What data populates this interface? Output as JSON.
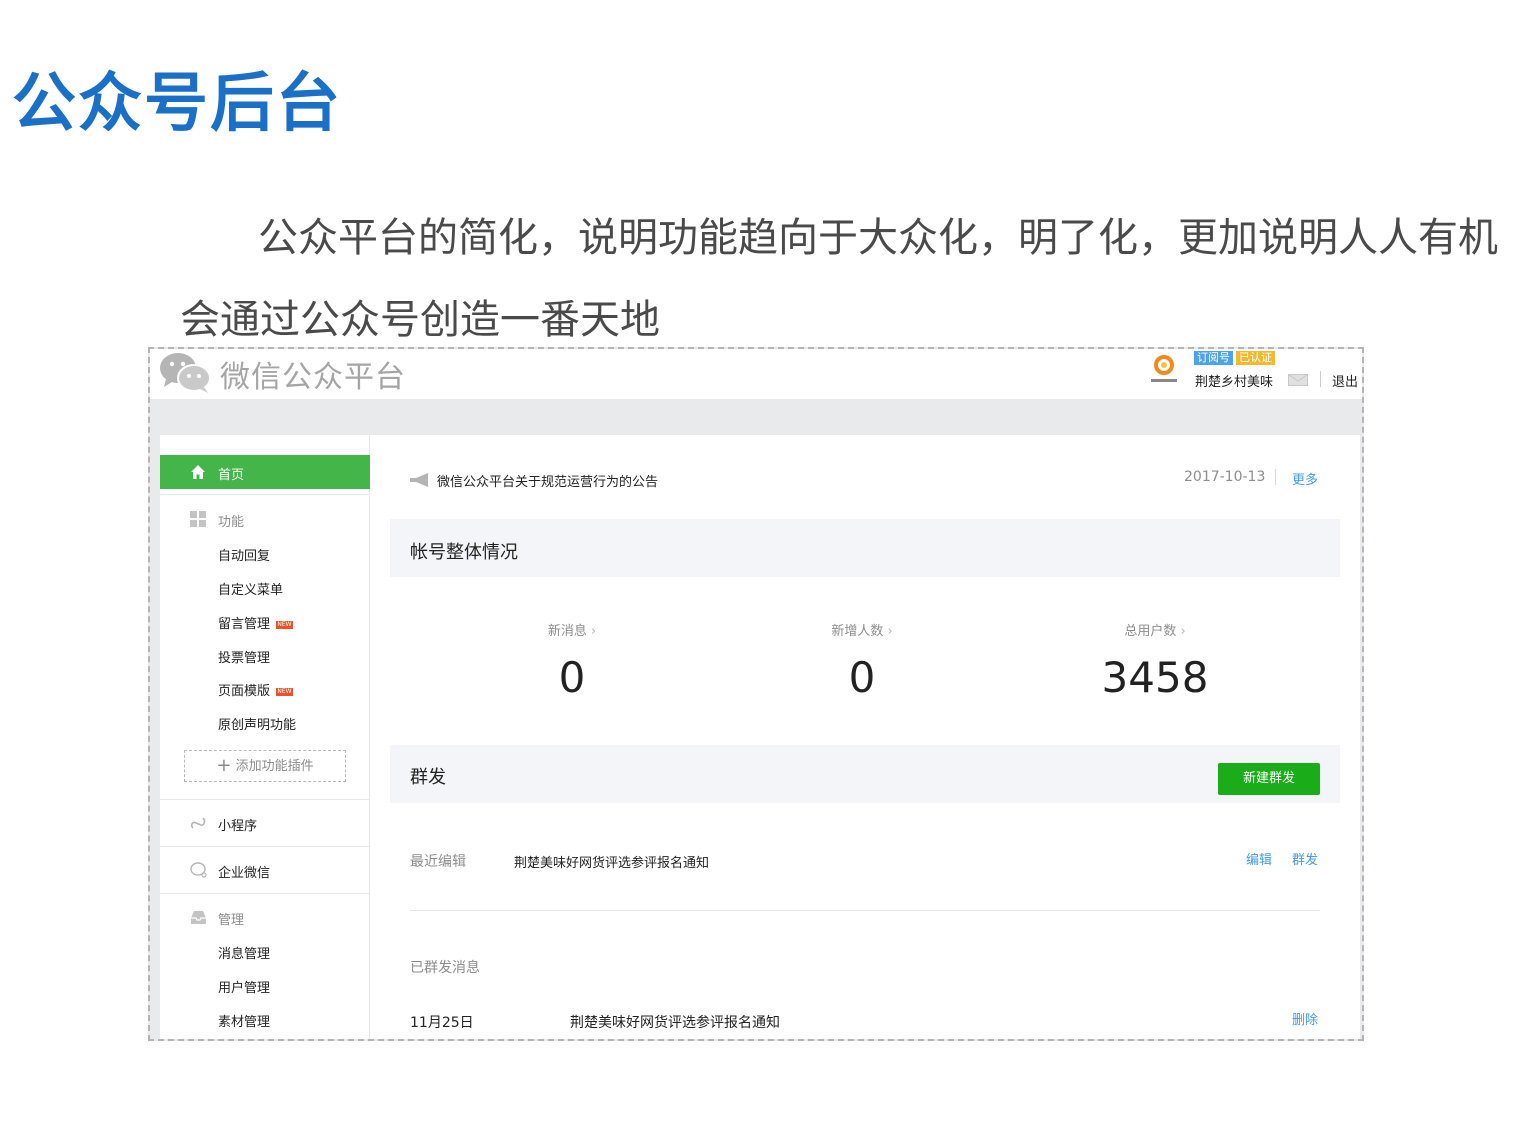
{
  "slide": {
    "title": "公众号后台",
    "description_line1": "公众平台的简化，说明功能趋向于大众化，明了化，更加说明人人有机",
    "description_line2": "会通过公众号创造一番天地"
  },
  "header": {
    "logo_text": "微信公众平台",
    "account_type_tag": "订阅号",
    "verified_tag": "已认证",
    "account_name": "荆楚乡村美味",
    "logout_label": "退出"
  },
  "sidebar": {
    "home_label": "首页",
    "features_group": "功能",
    "features_items": [
      {
        "label": "自动回复",
        "badge": ""
      },
      {
        "label": "自定义菜单",
        "badge": ""
      },
      {
        "label": "留言管理",
        "badge": "NEW"
      },
      {
        "label": "投票管理",
        "badge": ""
      },
      {
        "label": "页面模版",
        "badge": "NEW"
      },
      {
        "label": "原创声明功能",
        "badge": ""
      }
    ],
    "add_plugin_label": "添加功能插件",
    "mini_program": "小程序",
    "enterprise_wechat": "企业微信",
    "manage_group": "管理",
    "manage_items": [
      {
        "label": "消息管理"
      },
      {
        "label": "用户管理"
      },
      {
        "label": "素材管理"
      }
    ]
  },
  "notice": {
    "text": "微信公众平台关于规范运营行为的公告",
    "date": "2017-10-13",
    "more_label": "更多"
  },
  "overview": {
    "title": "帐号整体情况",
    "stats": [
      {
        "label": "新消息",
        "value": "0"
      },
      {
        "label": "新增人数",
        "value": "0"
      },
      {
        "label": "总用户数",
        "value": "3458"
      }
    ]
  },
  "mass_send": {
    "title": "群发",
    "new_button": "新建群发",
    "recent_edit_label": "最近编辑",
    "recent_edit_title": "荆楚美味好网货评选参评报名通知",
    "edit_label": "编辑",
    "send_label": "群发",
    "sent_label": "已群发消息",
    "sent_items": [
      {
        "date": "11月25日",
        "title": "荆楚美味好网货评选参评报名通知",
        "delete_label": "删除"
      }
    ]
  },
  "colors": {
    "title_blue": "#1a6fc7",
    "nav_active_green": "#44b549",
    "button_green": "#1aad19",
    "link_blue": "#459ae9"
  }
}
